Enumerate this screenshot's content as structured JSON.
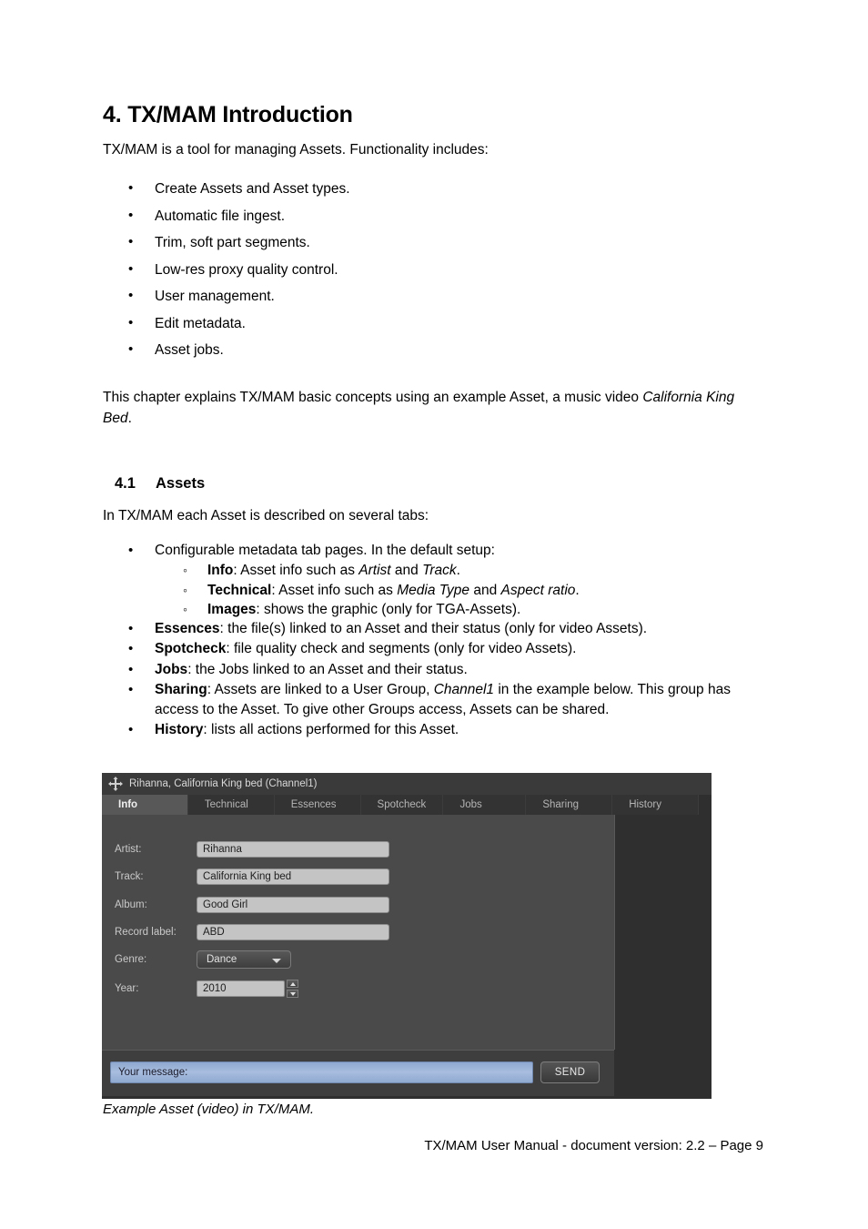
{
  "document": {
    "chapter_title": "4. TX/MAM Introduction",
    "intro_paragraph": "TX/MAM is a tool for managing Assets. Functionality includes:",
    "feature_bullets": [
      "Create Assets and Asset types.",
      "Automatic file ingest.",
      "Trim, soft part segments.",
      "Low-res proxy quality control.",
      "User management.",
      "Edit metadata.",
      "Asset jobs."
    ],
    "chapter_body_parts": {
      "pre": "This chapter explains TX/MAM basic concepts using an example Asset, a music video ",
      "italic": "California King Bed",
      "post": "."
    },
    "section": {
      "number": "4.1",
      "title": "Assets",
      "intro": "In TX/MAM each Asset is described on several tabs:"
    },
    "tab_bullets": {
      "configurable": "Configurable metadata tab pages. In the default setup:",
      "sub": [
        {
          "term": "Info",
          "pre": ": Asset info such as ",
          "italic1": "Artist",
          "mid": " and ",
          "italic2": "Track",
          "post": "."
        },
        {
          "term": "Technical",
          "pre": ": Asset info such as ",
          "italic1": "Media Type",
          "mid": " and ",
          "italic2": "Aspect ratio",
          "post": "."
        },
        {
          "term": "Images",
          "pre": ": shows the graphic (only for TGA-Assets).",
          "italic1": "",
          "mid": "",
          "italic2": "",
          "post": ""
        }
      ],
      "essences": {
        "term": "Essences",
        "text": ": the file(s) linked to an Asset and their status (only for video Assets)."
      },
      "spotcheck": {
        "term": "Spotcheck",
        "text": ": file quality check and segments (only for video Assets)."
      },
      "jobs": {
        "term": "Jobs",
        "text": ": the Jobs linked to an Asset and their status."
      },
      "sharing": {
        "term": "Sharing",
        "pre": ": Assets are linked to a User Group, ",
        "italic": "Channel1",
        "post": " in the example below.  This group has access to the Asset. To give other Groups access, Assets can be shared."
      },
      "history": {
        "term": "History",
        "text": ": lists all actions performed for this Asset."
      }
    },
    "figure_caption": "Example Asset (video) in TX/MAM.",
    "footer": "TX/MAM User Manual - document version: 2.2 – Page 9"
  },
  "app_screenshot": {
    "titlebar": {
      "move_icon": "move-icon",
      "title": "Rihanna, California King bed (Channel1)"
    },
    "tabs": [
      {
        "label": "Info",
        "active": true
      },
      {
        "label": "Technical",
        "active": false
      },
      {
        "label": "Essences",
        "active": false
      },
      {
        "label": "Spotcheck",
        "active": false
      },
      {
        "label": "Jobs",
        "active": false
      },
      {
        "label": "Sharing",
        "active": false
      },
      {
        "label": "History",
        "active": false
      }
    ],
    "form": {
      "artist": {
        "label": "Artist:",
        "value": "Rihanna"
      },
      "track": {
        "label": "Track:",
        "value": "California King bed"
      },
      "album": {
        "label": "Album:",
        "value": "Good Girl"
      },
      "record_label": {
        "label": "Record label:",
        "value": "ABD"
      },
      "genre": {
        "label": "Genre:",
        "value": "Dance",
        "icon": "chevron-down-icon"
      },
      "year": {
        "label": "Year:",
        "value": "2010",
        "icon": "spinner-icon"
      }
    },
    "message_bar": {
      "placeholder": "Your message:",
      "value": "Your message:",
      "send_label": "SEND"
    },
    "colors": {
      "window_bg": "#2f2f2f",
      "titlebar_bg": "#3a3a3a",
      "tab_bg": "#333333",
      "tab_active_bg": "#585858",
      "panel_bg": "#4a4a4a",
      "field_bg": "#c4c4c4",
      "message_bar_blue": "#a8bddf"
    }
  }
}
